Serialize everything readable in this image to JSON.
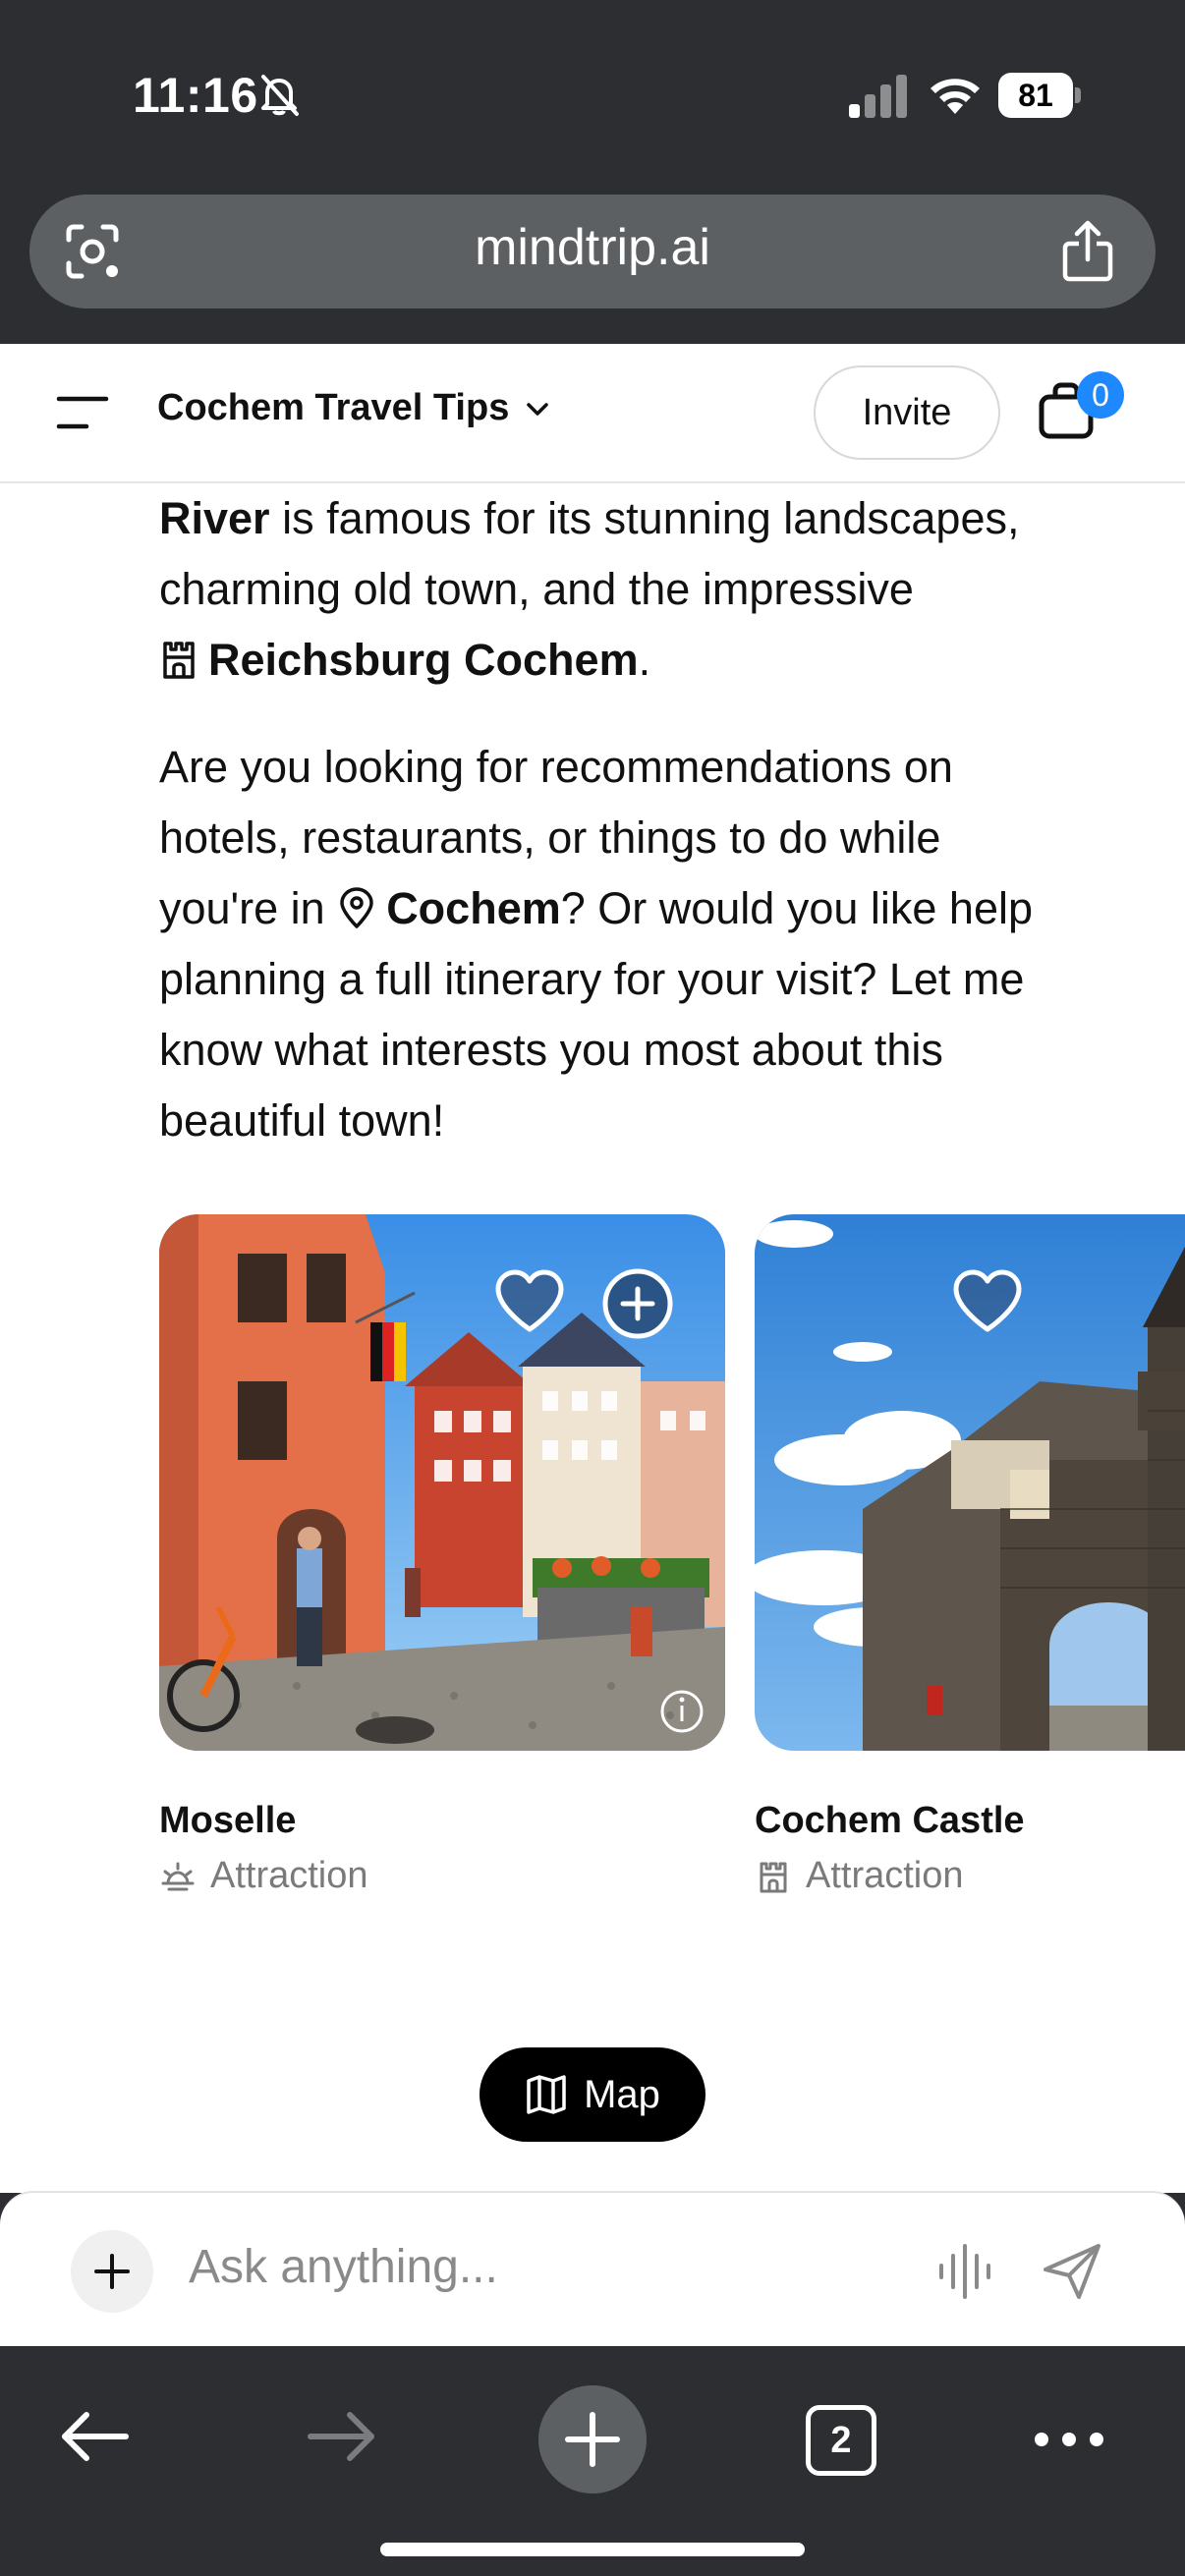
{
  "status_bar": {
    "time": "11:16",
    "battery": "81"
  },
  "browser": {
    "url": "mindtrip.ai",
    "tab_count": "2"
  },
  "header": {
    "trip_title": "Cochem Travel Tips",
    "invite_label": "Invite",
    "cart_count": "0"
  },
  "message": {
    "p1_line1_bold": "River",
    "p1_line1_rest": " is famous for its stunning landscapes,",
    "p1_line2": "charming old town, and the impressive",
    "p1_line3_bold": "Reichsburg Cochem",
    "p1_line3_end": ".",
    "p2_line1": "Are you looking for recommendations on",
    "p2_line2": "hotels, restaurants, or things to do while",
    "p2_line3_pre": "you're in ",
    "p2_line3_bold": "Cochem",
    "p2_line3_post": "? Or would you like help",
    "p2_line4": "planning a full itinerary for your visit? Let me",
    "p2_line5": "know what interests you most about this",
    "p2_line6": "beautiful town!"
  },
  "cards": [
    {
      "title": "Moselle",
      "category": "Attraction",
      "category_icon": "sun-icon"
    },
    {
      "title": "Cochem Castle",
      "category": "Attraction",
      "category_icon": "castle-icon"
    }
  ],
  "map_button": {
    "label": "Map"
  },
  "composer": {
    "placeholder": "Ask anything..."
  },
  "colors": {
    "accent_badge": "#1e88ff",
    "chrome": "#2c2e31",
    "url_bar": "#5d6063"
  }
}
